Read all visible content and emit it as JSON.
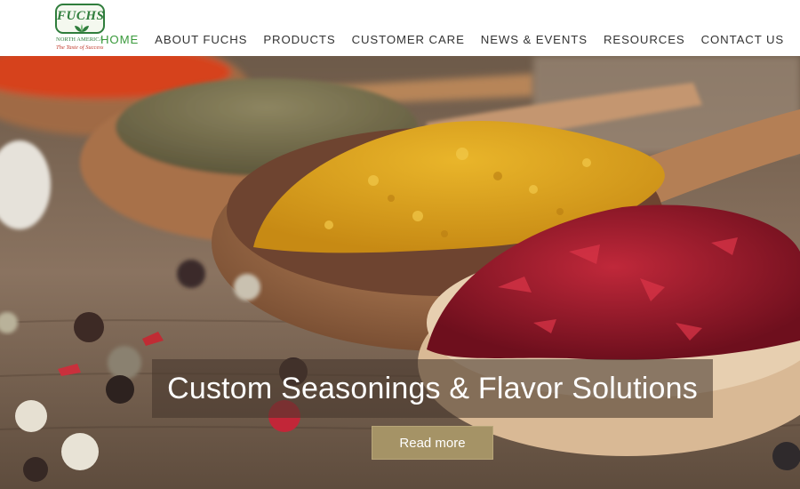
{
  "brand": {
    "logo_word": "FUCHS",
    "logo_sub": "NORTH AMERICA",
    "logo_tagline": "The Taste of Success",
    "colors": {
      "green": "#2f7d3c",
      "active_nav": "#3a9a3c",
      "tagline_red": "#c0392b"
    }
  },
  "nav": {
    "items": [
      {
        "label": "HOME",
        "active": true
      },
      {
        "label": "ABOUT FUCHS",
        "active": false
      },
      {
        "label": "PRODUCTS",
        "active": false
      },
      {
        "label": "CUSTOMER CARE",
        "active": false
      },
      {
        "label": "NEWS & EVENTS",
        "active": false
      },
      {
        "label": "RESOURCES",
        "active": false
      },
      {
        "label": "CONTACT US",
        "active": false
      }
    ]
  },
  "hero": {
    "caption": "Custom Seasonings & Flavor Solutions",
    "button_label": "Read more",
    "button_color": "#a59366"
  }
}
